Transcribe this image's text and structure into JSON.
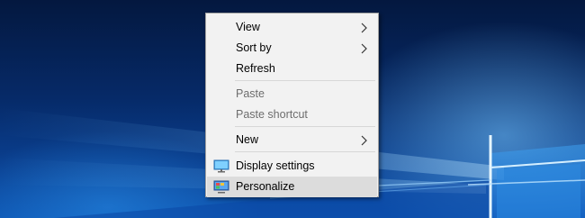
{
  "desktop": {
    "wallpaper": "windows-10-hero",
    "colors": {
      "deep": "#04183f",
      "mid": "#0a3f8f",
      "light": "#0d55b2",
      "glow": "#a8dcff"
    }
  },
  "context_menu": {
    "background": "#f2f2f2",
    "hover_color": "#dcdcdc",
    "items": [
      {
        "label": "View",
        "has_submenu": true,
        "enabled": true
      },
      {
        "label": "Sort by",
        "has_submenu": true,
        "enabled": true
      },
      {
        "label": "Refresh",
        "has_submenu": false,
        "enabled": true
      },
      {
        "label": "Paste",
        "has_submenu": false,
        "enabled": false
      },
      {
        "label": "Paste shortcut",
        "has_submenu": false,
        "enabled": false
      },
      {
        "label": "New",
        "has_submenu": true,
        "enabled": true
      },
      {
        "label": "Display settings",
        "icon": "display-icon",
        "has_submenu": false,
        "enabled": true
      },
      {
        "label": "Personalize",
        "icon": "personalize-icon",
        "has_submenu": false,
        "enabled": true,
        "highlighted": true
      }
    ]
  }
}
